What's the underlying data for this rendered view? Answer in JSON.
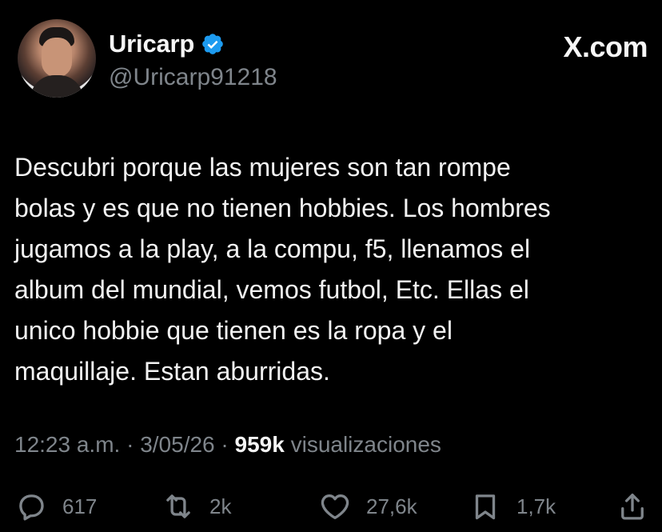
{
  "author": {
    "name": "Uricarp",
    "handle": "@Uricarp91218"
  },
  "brand": "X.com",
  "tweet": {
    "text": "Descubri porque las mujeres son tan rompe\nbolas y es que no tienen hobbies. Los hombres\njugamos a la play, a la compu, f5, llenamos el\nalbum del mundial, vemos futbol, Etc. Ellas el\nunico hobbie que tienen es la ropa y el\nmaquillaje. Estan aburridas."
  },
  "meta": {
    "time": "12:23 a.m.",
    "separator_1": " · ",
    "date": "3/05/26",
    "separator_2": " · ",
    "views_count": "959k",
    "views_label": " visualizaciones"
  },
  "actions": {
    "reply_count": "617",
    "retweet_count": "2k",
    "like_count": "27,6k",
    "bookmark_count": "1,7k"
  },
  "icons": {
    "verified": "verified-badge-icon",
    "reply": "reply-icon",
    "retweet": "retweet-icon",
    "like": "heart-icon",
    "bookmark": "bookmark-icon",
    "share": "share-icon"
  },
  "colors": {
    "background": "#000000",
    "text": "#f2f2f2",
    "secondary": "#7f858b",
    "verified": "#1d9bf0"
  }
}
